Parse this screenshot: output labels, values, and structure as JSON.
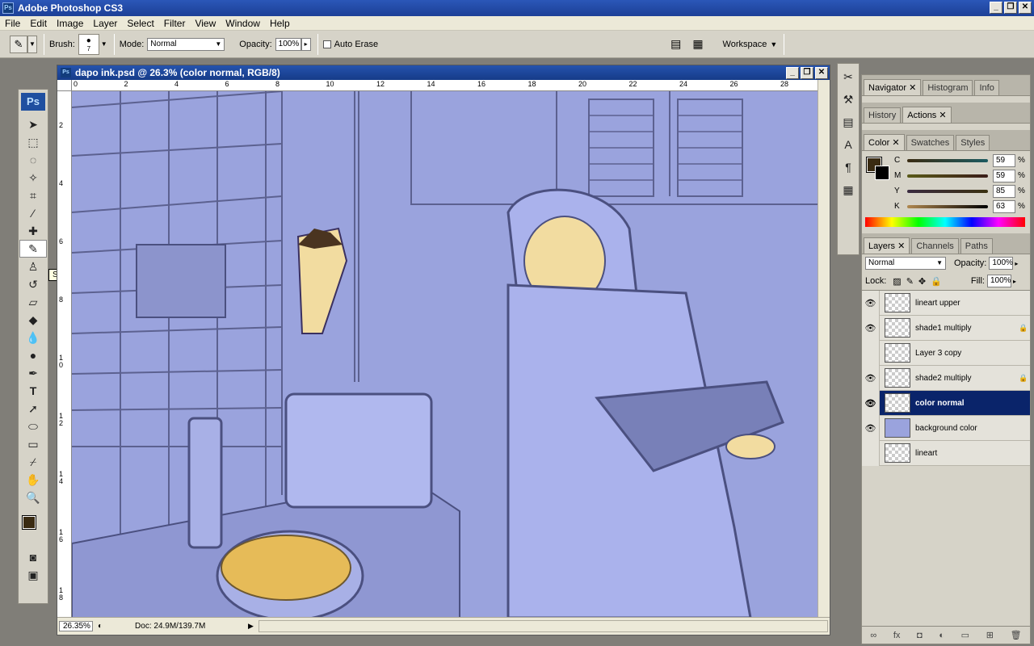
{
  "app": {
    "title": "Adobe Photoshop CS3",
    "icon": "ps-app-icon"
  },
  "window_controls": {
    "minimize": "_",
    "maximize": "❐",
    "close": "✕"
  },
  "menu": [
    "File",
    "Edit",
    "Image",
    "Layer",
    "Select",
    "Filter",
    "View",
    "Window",
    "Help"
  ],
  "options": {
    "brush_label": "Brush:",
    "brush_size": "7",
    "mode_label": "Mode:",
    "mode_value": "Normal",
    "opacity_label": "Opacity:",
    "opacity_value": "100%",
    "auto_erase_label": "Auto Erase",
    "workspace_label": "Workspace"
  },
  "tooltip": "Shift",
  "document": {
    "title": "dapo ink.psd @ 26.3% (color normal, RGB/8)",
    "zoom": "26.35%",
    "doc_size": "Doc: 24.9M/139.7M",
    "ruler_h": [
      "0",
      "2",
      "4",
      "6",
      "8",
      "10",
      "12",
      "14",
      "16",
      "18",
      "20",
      "22",
      "24",
      "26",
      "28"
    ],
    "ruler_v": [
      "2",
      "4",
      "6",
      "8",
      "10",
      "12",
      "14",
      "16",
      "18"
    ]
  },
  "panels": {
    "group1_tabs": [
      "Navigator",
      "Histogram",
      "Info"
    ],
    "group2_tabs": [
      "History",
      "Actions"
    ],
    "group3_tabs": [
      "Color",
      "Swatches",
      "Styles"
    ],
    "color": [
      {
        "label": "C",
        "value": "59"
      },
      {
        "label": "M",
        "value": "59"
      },
      {
        "label": "Y",
        "value": "85"
      },
      {
        "label": "K",
        "value": "63"
      }
    ],
    "percent": "%",
    "layers_tabs": [
      "Layers",
      "Channels",
      "Paths"
    ],
    "blend_mode": "Normal",
    "opacity_label": "Opacity:",
    "opacity_value": "100%",
    "lock_label": "Lock:",
    "fill_label": "Fill:",
    "fill_value": "100%",
    "layers": [
      {
        "name": "lineart upper",
        "visible": true,
        "locked": false
      },
      {
        "name": "shade1 multiply",
        "visible": true,
        "locked": true
      },
      {
        "name": "Layer 3 copy",
        "visible": false,
        "locked": false
      },
      {
        "name": "shade2 multiply",
        "visible": true,
        "locked": true
      },
      {
        "name": "color normal",
        "visible": true,
        "locked": false,
        "selected": true
      },
      {
        "name": "background color",
        "visible": true,
        "locked": false
      },
      {
        "name": "lineart",
        "visible": false,
        "locked": false
      }
    ]
  },
  "colors": {
    "canvas": "#9aa3dd",
    "skin": "#f2dca0",
    "foreground": "#3a2b12",
    "title_blue": "#1c3f96"
  }
}
